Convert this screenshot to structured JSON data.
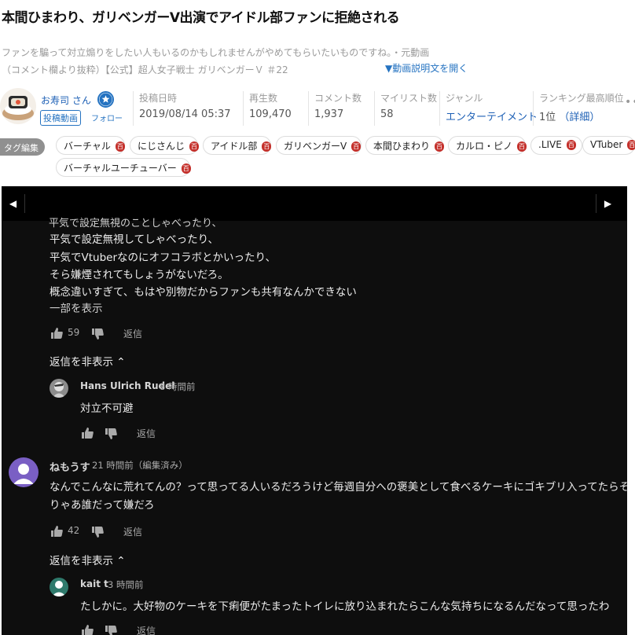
{
  "video": {
    "title": "本間ひまわり、ガリベンガーV出演でアイドル部ファンに拒絶される",
    "description_lines": [
      "ファンを騙って対立煽りをしたい人もいるのかもしれませんがやめてもらいたいものですね。・元動画",
      "（コメント欄より抜粋）【公式】超人女子戦士 ガリベンガーＶ ＃22"
    ],
    "description_toggle": "▼動画説明文を開く"
  },
  "owner": {
    "name": "お寿司 さん",
    "badge": "投稿動画",
    "follow_label": "フォロー"
  },
  "stats": {
    "posted": {
      "label": "投稿日時",
      "value": "2019/08/14 05:37"
    },
    "views": {
      "label": "再生数",
      "value": "109,470"
    },
    "comments": {
      "label": "コメント数",
      "value": "1,937"
    },
    "mylist": {
      "label": "マイリスト数",
      "value": "58"
    },
    "genre": {
      "label": "ジャンル",
      "value": "エンターテイメント"
    },
    "ranking": {
      "label": "ランキング最高順位",
      "value": "1位",
      "detail": "（詳細）"
    },
    "more": "••"
  },
  "tags": {
    "edit_label": "タグ編集",
    "dic_mark": "百",
    "items": [
      "バーチャル",
      "にじさんじ",
      "アイドル部",
      "ガリベンガーV",
      "本間ひまわり",
      "カルロ・ピノ",
      ".LIVE",
      "VTuber",
      "バーチャルユーチューバー"
    ]
  },
  "panel": {
    "prev": "◀",
    "next": "▶",
    "cut_line": "平気で設定無視のことしゃべったり、",
    "comment1": {
      "lines": [
        "平気で設定無視してしゃべったり、",
        "平気でVtuberなのにオフコラボとかいったり、",
        "そら嫌煙されてもしょうがないだろ。",
        "概念違いすぎて、もはや別物だからファンも共有なんかできない"
      ],
      "show_more": "一部を表示",
      "likes": "59",
      "reply": "返信",
      "hide_replies": "返信を非表示 ⌃"
    },
    "reply1": {
      "author": "Hans Ulrich Rudel",
      "time": "8 時間前",
      "text": "対立不可避",
      "reply": "返信"
    },
    "comment2": {
      "author": "ねもうす",
      "time": "21 時間前（編集済み）",
      "lines": [
        "なんでこんなに荒れてんの？って思ってる人いるだろうけど毎週自分への褒美として食べるケーキにゴキブリ入ってたらそ",
        "りゃあ誰だって嫌だろ"
      ],
      "likes": "42",
      "reply": "返信",
      "hide_replies": "返信を非表示 ⌃"
    },
    "reply2": {
      "author": "kait t",
      "time": "3 時間前",
      "text": "たしかに。大好物のケーキを下痢便がたまったトイレに放り込まれたらこんな気持ちになるんだなって思ったわ",
      "reply": "返信"
    }
  },
  "colors": {
    "link": "#1c5fb5",
    "accent": "#2573c1",
    "panel_bg": "#0e0e0e",
    "dic_red": "#c4302b",
    "avatar_purple": "#7a5fc4",
    "avatar_teal": "#2f7a6c"
  },
  "icons": [
    "star-follow-icon",
    "thumb-up-icon",
    "thumb-down-icon",
    "nav-prev-icon",
    "nav-next-icon",
    "dic-icon"
  ]
}
